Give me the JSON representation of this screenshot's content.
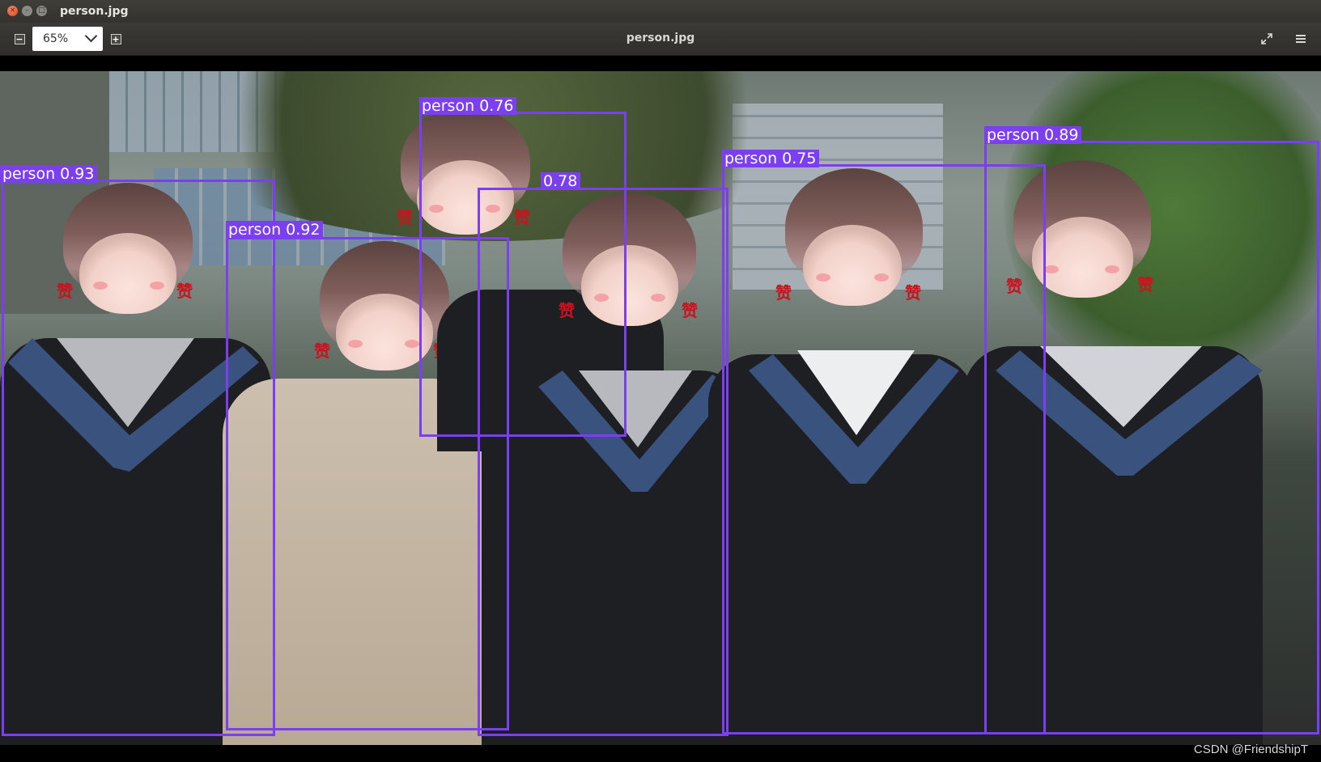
{
  "window": {
    "title": "person.jpg"
  },
  "toolbar": {
    "zoom_value": "65%",
    "document_title": "person.jpg",
    "zoom_out_icon": "minus",
    "zoom_in_icon": "plus"
  },
  "detections": [
    {
      "label": "person 0.93",
      "class": "person",
      "score": 0.93
    },
    {
      "label": "person 0.92",
      "class": "person",
      "score": 0.92
    },
    {
      "label": "person 0.76",
      "class": "person",
      "score": 0.76
    },
    {
      "label": "0.78",
      "class": "person",
      "score": 0.78
    },
    {
      "label": "person 0.75",
      "class": "person",
      "score": 0.75
    },
    {
      "label": "person 0.89",
      "class": "person",
      "score": 0.89
    }
  ],
  "stickers": {
    "zan": "赞"
  },
  "watermark": "CSDN @FriendshipT",
  "colors": {
    "box": "#7b3ff0",
    "titlebar": "#3b3a36",
    "zan": "#c8141f"
  }
}
